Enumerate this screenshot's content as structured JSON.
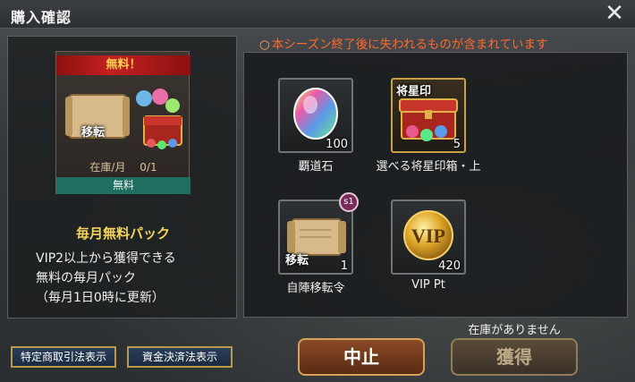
{
  "header": {
    "title": "購入確認",
    "close_label": "✕"
  },
  "pack": {
    "ribbon": "無料！",
    "art_label": "移転",
    "stock_label": "在庫/月",
    "stock_value": "0/1",
    "free_label": "無料",
    "name": "毎月無料パック",
    "desc_lines": [
      "VIP2以上から獲得できる",
      "無料の毎月パック",
      "（毎月1日0時に更新）"
    ]
  },
  "warning": {
    "ring": "○",
    "text": "本シーズン終了後に失われるものが含まれています"
  },
  "items": [
    {
      "name": "覇道石",
      "qty": "100",
      "tag": "",
      "badge": "",
      "icon": "gem-icon"
    },
    {
      "name": "選べる将星印箱・上",
      "qty": "5",
      "tag": "将星印",
      "badge": "",
      "icon": "treasure-box-icon"
    },
    {
      "name": "自陣移転令",
      "qty": "1",
      "tag": "移転",
      "badge": "s1",
      "icon": "scroll-icon"
    },
    {
      "name": "VIP Pt",
      "qty": "420",
      "tag": "",
      "badge": "",
      "icon": "vip-coin-icon"
    }
  ],
  "footer": {
    "law_btn_1": "特定商取引法表示",
    "law_btn_2": "資金決済法表示",
    "cancel_label": "中止",
    "get_label": "獲得",
    "out_of_stock": "在庫がありません"
  },
  "colors": {
    "warning": "#ff6a2a",
    "pack_name": "#f4d45a",
    "free_bar": "#1f6e5f",
    "ribbon": "#c42020"
  }
}
